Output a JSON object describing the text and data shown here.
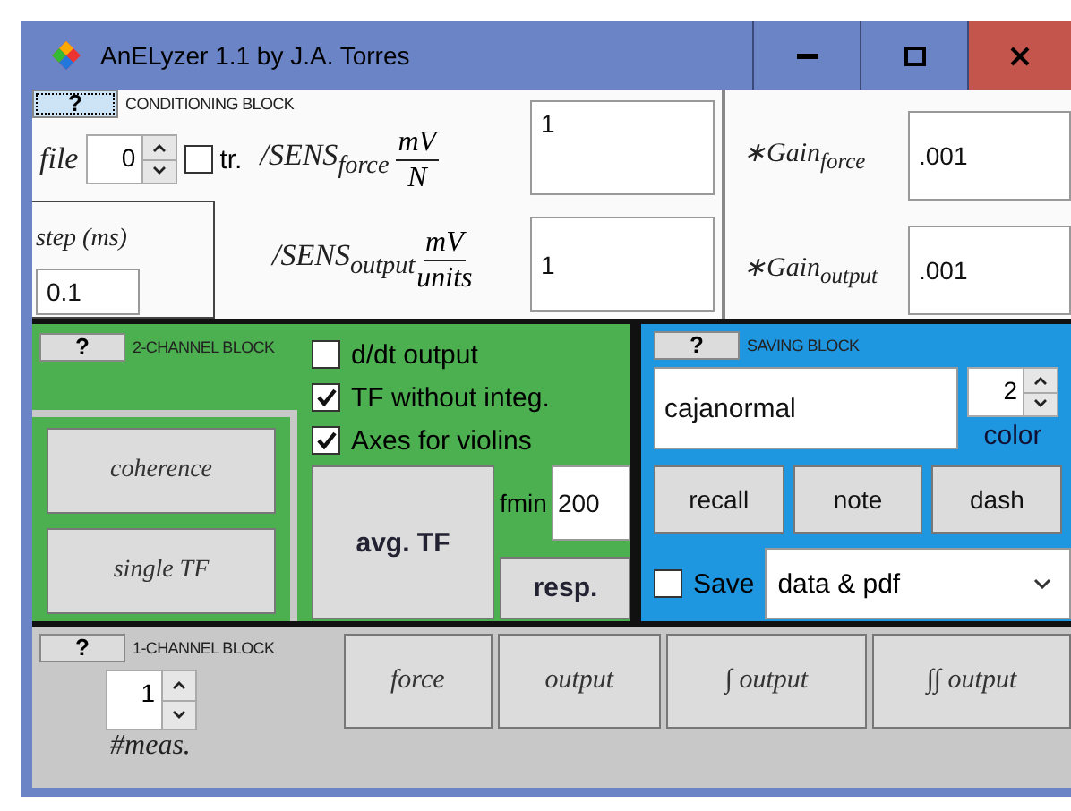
{
  "window": {
    "title": "AnELyzer 1.1 by J.A. Torres"
  },
  "conditioning": {
    "help": "?",
    "title": "CONDITIONING BLOCK",
    "file": {
      "label": "file",
      "value": "0"
    },
    "tr": {
      "label": "tr.",
      "checked": false
    },
    "sens_force": {
      "label": "/SENS$_{force}$",
      "numerator": "mV",
      "denominator": "N",
      "value": "1"
    },
    "step": {
      "label": "step (ms)",
      "value": "0.1"
    },
    "sens_output": {
      "label": "/SENS$_{output}$",
      "numerator": "mV",
      "denominator": "units",
      "value": "1"
    }
  },
  "gains": [
    {
      "label": "∗Gain$_{force}$",
      "value": ".001"
    },
    {
      "label": "∗Gain$_{output}$",
      "value": ".001"
    }
  ],
  "two_channel": {
    "help": "?",
    "title": "2-CHANNEL BLOCK",
    "options": [
      {
        "label": "d/dt output",
        "checked": false
      },
      {
        "label": "TF without integ.",
        "checked": true
      },
      {
        "label": "Axes for violins",
        "checked": true
      }
    ],
    "side_buttons": [
      "coherence",
      "single TF"
    ],
    "avg_button": "avg. TF",
    "fmin": {
      "label": "fmin",
      "value": "200"
    },
    "resp_button": "resp."
  },
  "saving": {
    "help": "?",
    "title": "SAVING BLOCK",
    "name": "cajanormal",
    "color": {
      "value": "2",
      "label": "color"
    },
    "buttons": [
      "recall",
      "note",
      "dash"
    ],
    "save": {
      "label": "Save",
      "checked": false
    },
    "format": "data & pdf"
  },
  "one_channel": {
    "help": "?",
    "title": "1-CHANNEL BLOCK",
    "meas": {
      "value": "1",
      "label": "#meas."
    },
    "buttons": [
      "force",
      "output",
      "∫ output",
      "∫∫ output"
    ]
  }
}
